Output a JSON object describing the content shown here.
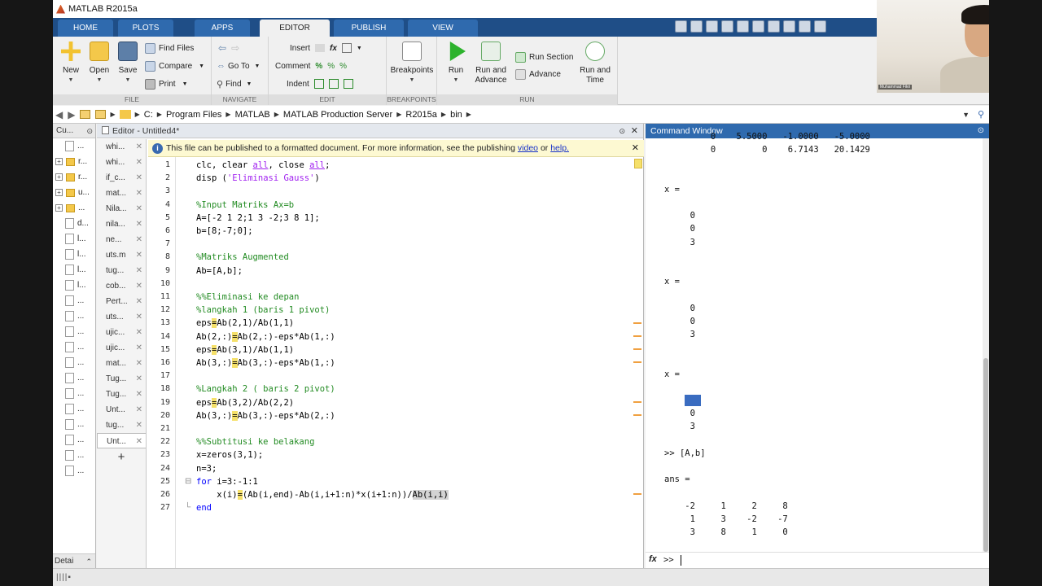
{
  "window": {
    "title": "MATLAB R2015a"
  },
  "tabs": [
    "HOME",
    "PLOTS",
    "APPS",
    "EDITOR",
    "PUBLISH",
    "VIEW"
  ],
  "ribbon": {
    "file": {
      "label": "FILE",
      "new": "New",
      "open": "Open",
      "save": "Save",
      "find_files": "Find Files",
      "compare": "Compare",
      "print": "Print"
    },
    "navigate": {
      "label": "NAVIGATE",
      "goto": "Go To",
      "find": "Find"
    },
    "edit": {
      "label": "EDIT",
      "insert": "Insert",
      "comment": "Comment",
      "indent": "Indent",
      "fx": "fx"
    },
    "breakpoints": {
      "label": "BREAKPOINTS",
      "breakpoints": "Breakpoints"
    },
    "run": {
      "label": "RUN",
      "run": "Run",
      "run_advance": "Run and Advance",
      "run_section": "Run Section",
      "advance": "Advance",
      "run_time": "Run and Time"
    }
  },
  "address": {
    "crumbs": [
      "C:",
      "Program Files",
      "MATLAB",
      "MATLAB Production Server",
      "R2015a",
      "bin"
    ]
  },
  "current_folder": {
    "header": "Cu...",
    "items": [
      {
        "label": "...",
        "type": "file",
        "expand": false
      },
      {
        "label": "r...",
        "type": "folder",
        "expand": true
      },
      {
        "label": "r...",
        "type": "folder",
        "expand": true
      },
      {
        "label": "u...",
        "type": "folder",
        "expand": true
      },
      {
        "label": "...",
        "type": "folder",
        "expand": true
      },
      {
        "label": "d...",
        "type": "file",
        "expand": false
      },
      {
        "label": "l...",
        "type": "file",
        "expand": false
      },
      {
        "label": "l...",
        "type": "file",
        "expand": false
      },
      {
        "label": "l...",
        "type": "file",
        "expand": false
      },
      {
        "label": "l...",
        "type": "file",
        "expand": false
      },
      {
        "label": "...",
        "type": "file",
        "expand": false
      },
      {
        "label": "...",
        "type": "file",
        "expand": false
      },
      {
        "label": "...",
        "type": "file",
        "expand": false
      },
      {
        "label": "...",
        "type": "file",
        "expand": false
      },
      {
        "label": "...",
        "type": "file",
        "expand": false
      },
      {
        "label": "...",
        "type": "file",
        "expand": false
      },
      {
        "label": "...",
        "type": "file",
        "expand": false
      },
      {
        "label": "...",
        "type": "file",
        "expand": false
      },
      {
        "label": "...",
        "type": "file",
        "expand": false
      },
      {
        "label": "...",
        "type": "file",
        "expand": false
      },
      {
        "label": "...",
        "type": "file",
        "expand": false
      },
      {
        "label": "...",
        "type": "file",
        "expand": false
      }
    ],
    "footer": "Detai"
  },
  "editor": {
    "header": "Editor - Untitled4*",
    "info_text": "This file can be published to a formatted document. For more information, see the publishing",
    "info_link1": "video",
    "info_or": "or",
    "info_link2": "help.",
    "docs": [
      "whi...",
      "whi...",
      "if_c...",
      "mat...",
      "Nila...",
      "nila...",
      "ne...",
      "uts.m",
      "tug...",
      "cob...",
      "Pert...",
      "uts...",
      "ujic...",
      "ujic...",
      "mat...",
      "Tug...",
      "Tug...",
      "Unt...",
      "tug...",
      "Unt..."
    ],
    "add_tab": "+",
    "lines": [
      {
        "n": "1",
        "html": "clc, clear <u class='st'>all</u>, close <u class='st'>all</u>;"
      },
      {
        "n": "2",
        "html": "disp (<span class='st'>'Eliminasi Gauss'</span>)"
      },
      {
        "n": "3",
        "html": ""
      },
      {
        "n": "4",
        "html": "<span class='cm'>%Input Matriks Ax=b</span>"
      },
      {
        "n": "5",
        "html": "A=[-2 1 2;1 3 -2;3 8 1];"
      },
      {
        "n": "6",
        "html": "b=[8;-7;0];"
      },
      {
        "n": "7",
        "html": ""
      },
      {
        "n": "8",
        "html": "<span class='cm'>%Matriks Augmented</span>"
      },
      {
        "n": "9",
        "html": "Ab=[A,b];"
      },
      {
        "n": "10",
        "html": ""
      },
      {
        "n": "11",
        "html": "<span class='cm'>%%Eliminasi ke depan</span>"
      },
      {
        "n": "12",
        "html": "<span class='cm'>%langkah 1 (baris 1 pivot)</span>"
      },
      {
        "n": "13",
        "html": "eps<span class='hl'>=</span>Ab(2,1)/Ab(1,1)"
      },
      {
        "n": "14",
        "html": "Ab(2,:)<span class='hl'>=</span>Ab(2,:)-eps*Ab(1,:)"
      },
      {
        "n": "15",
        "html": "eps<span class='hl'>=</span>Ab(3,1)/Ab(1,1)"
      },
      {
        "n": "16",
        "html": "Ab(3,:)<span class='hl'>=</span>Ab(3,:)-eps*Ab(1,:)"
      },
      {
        "n": "17",
        "html": ""
      },
      {
        "n": "18",
        "html": "<span class='cm'>%Langkah 2 ( baris 2 pivot)</span>"
      },
      {
        "n": "19",
        "html": "eps<span class='hl'>=</span>Ab(3,2)/Ab(2,2)"
      },
      {
        "n": "20",
        "html": "Ab(3,:)<span class='hl'>=</span>Ab(3,:)-eps*Ab(2,:)"
      },
      {
        "n": "21",
        "html": ""
      },
      {
        "n": "22",
        "html": "<span class='cm'>%%Subtitusi ke belakang</span>"
      },
      {
        "n": "23",
        "html": "x=zeros(3,1);"
      },
      {
        "n": "24",
        "html": "n=3;"
      },
      {
        "n": "25",
        "html": "<span class='kw'>for</span> i=3:-1:1"
      },
      {
        "n": "26",
        "html": "    x(i)<span class='hl'>=</span>(Ab(i,end)-Ab(i,i+1:n)*x(i+1:n))/<span class='sel'>Ab(i,i)</span>"
      },
      {
        "n": "27",
        "html": "<span class='kw'>end</span>"
      }
    ]
  },
  "command_window": {
    "header": "Command Window",
    "lines": [
      "         0    5.5000   -1.0000   -5.0000",
      "         0         0    6.7143   20.1429",
      "",
      "",
      "x =",
      "",
      "     0",
      "     0",
      "     3",
      "",
      "",
      "x =",
      "",
      "     0",
      "     0",
      "     3",
      "",
      "",
      "x =",
      "",
      "    -1",
      "     0",
      "     3",
      "",
      ">> [A,b]",
      "",
      "ans =",
      "",
      "    -2     1     2     8",
      "     1     3    -2    -7",
      "     3     8     1     0"
    ],
    "prompt": ">>",
    "fx": "fx"
  },
  "webcam": {
    "name": "Muhammad Fikri"
  }
}
